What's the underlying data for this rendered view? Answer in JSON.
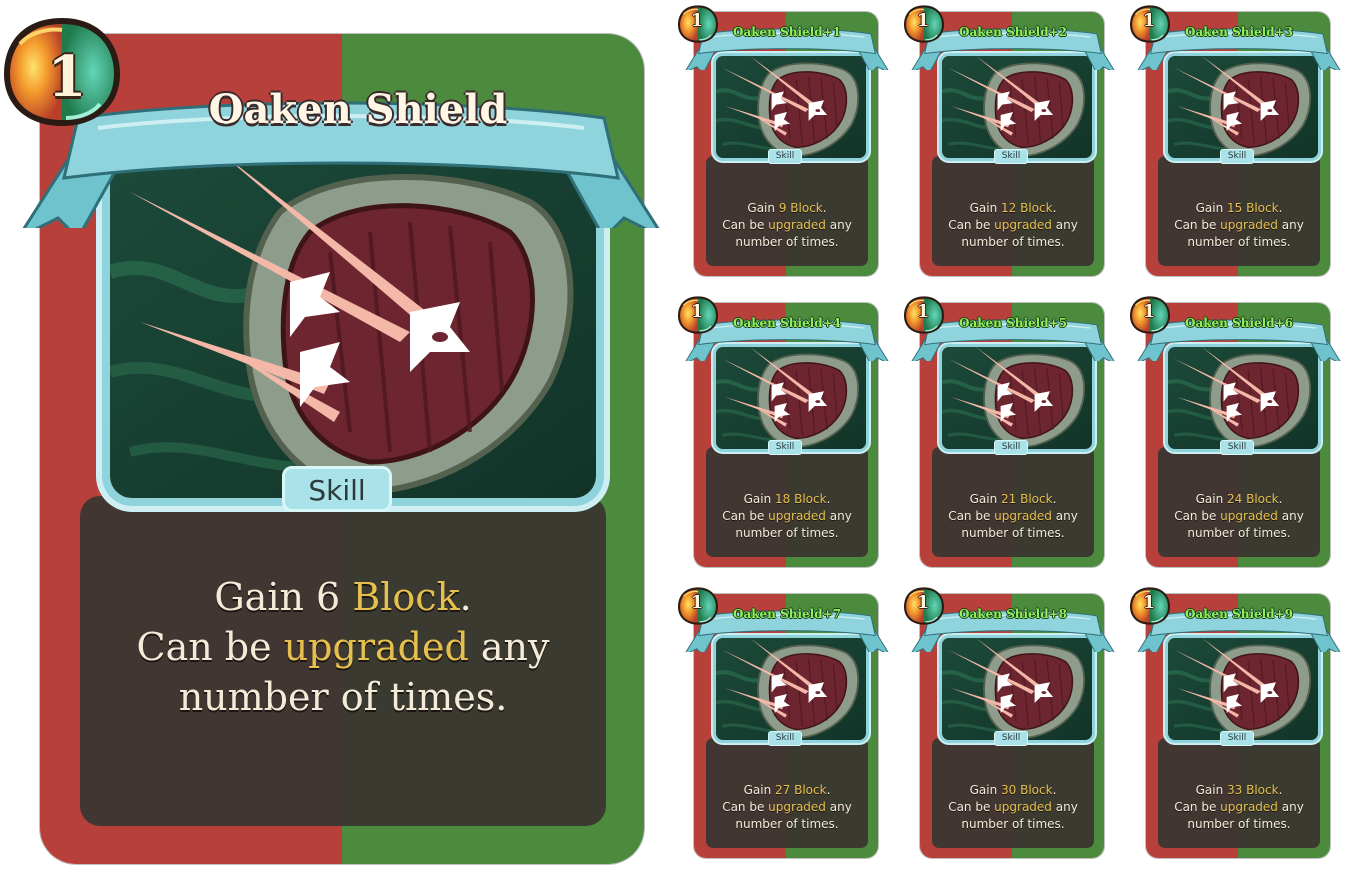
{
  "colors": {
    "frame_red": "#b8403a",
    "frame_green": "#4c8b3e",
    "panel_red": "#423632",
    "panel_green": "#3b3a30",
    "banner": "#8fd3dc",
    "highlight": "#e6c04e",
    "upgraded_title": "#8df15a"
  },
  "icons": {
    "cost_orb": "energy-orb-icon",
    "art": "oaken-shield-art"
  },
  "main_card": {
    "cost": "1",
    "title": "Oaken Shield",
    "type": "Skill",
    "desc": {
      "gain": "Gain",
      "block_value": "6",
      "block_word": "Block",
      "period": ".",
      "line2_a": "Can be",
      "upgraded_word": "upgraded",
      "line2_b": "any",
      "line3": "number of times."
    }
  },
  "upgrades": [
    {
      "cost": "1",
      "title": "Oaken Shield+1",
      "type": "Skill",
      "block_value": "9"
    },
    {
      "cost": "1",
      "title": "Oaken Shield+2",
      "type": "Skill",
      "block_value": "12"
    },
    {
      "cost": "1",
      "title": "Oaken Shield+3",
      "type": "Skill",
      "block_value": "15"
    },
    {
      "cost": "1",
      "title": "Oaken Shield+4",
      "type": "Skill",
      "block_value": "18"
    },
    {
      "cost": "1",
      "title": "Oaken Shield+5",
      "type": "Skill",
      "block_value": "21"
    },
    {
      "cost": "1",
      "title": "Oaken Shield+6",
      "type": "Skill",
      "block_value": "24"
    },
    {
      "cost": "1",
      "title": "Oaken Shield+7",
      "type": "Skill",
      "block_value": "27"
    },
    {
      "cost": "1",
      "title": "Oaken Shield+8",
      "type": "Skill",
      "block_value": "30"
    },
    {
      "cost": "1",
      "title": "Oaken Shield+9",
      "type": "Skill",
      "block_value": "33"
    }
  ]
}
